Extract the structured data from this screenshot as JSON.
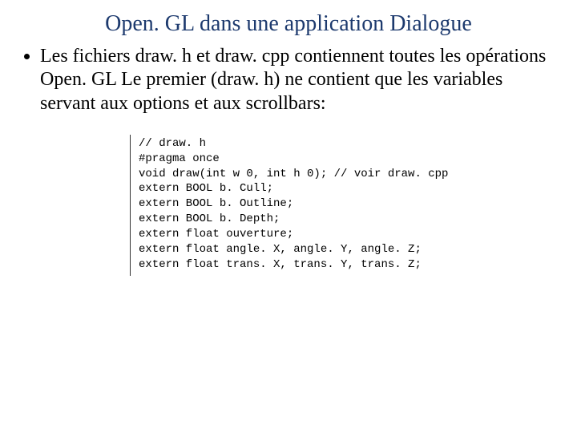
{
  "title": "Open. GL dans une application Dialogue",
  "bullet_1": "Les fichiers draw. h et draw. cpp contiennent toutes les opérations Open. GL Le premier (draw. h) ne contient que les variables servant aux options et aux scrollbars:",
  "code": {
    "l1": "// draw. h",
    "l2": "#pragma once",
    "l3": "",
    "l4": "void draw(int w 0, int h 0); // voir draw. cpp",
    "l5": "",
    "l6": "extern BOOL b. Cull;",
    "l7": "extern BOOL b. Outline;",
    "l8": "extern BOOL b. Depth;",
    "l9": "",
    "l10": "extern float ouverture;",
    "l11": "extern float angle. X, angle. Y, angle. Z;",
    "l12": "extern float trans. X, trans. Y, trans. Z;"
  }
}
